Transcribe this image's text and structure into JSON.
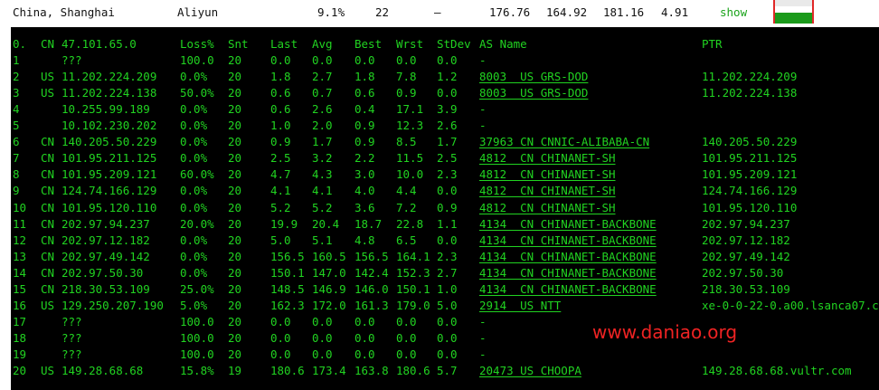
{
  "summary": {
    "location": "China, Shanghai",
    "provider": "Aliyun",
    "loss": "9.1%",
    "hops": "22",
    "dash": "–",
    "v1": "176.76",
    "v2": "164.92",
    "v3": "181.16",
    "v4": "4.91",
    "show_label": "show"
  },
  "colors": {
    "terminal_bg": "#000000",
    "terminal_text": "#21d321",
    "watermark": "#ef2323",
    "show_link": "#1aa31a"
  },
  "table": {
    "headers": [
      "0.",
      "CN",
      "47.101.65.0",
      "Loss%",
      "Snt",
      "Last",
      "Avg",
      "Best",
      "Wrst",
      "StDev",
      "AS Name",
      "PTR"
    ],
    "rows": [
      [
        "1",
        "",
        "???",
        "100.0",
        "20",
        "0.0",
        "0.0",
        "0.0",
        "0.0",
        "0.0",
        "-",
        ""
      ],
      [
        "2",
        "US",
        "11.202.224.209",
        "0.0%",
        "20",
        "1.8",
        "2.7",
        "1.8",
        "7.8",
        "1.2",
        "8003  US GRS-DOD",
        "11.202.224.209"
      ],
      [
        "3",
        "US",
        "11.202.224.138",
        "50.0%",
        "20",
        "0.6",
        "0.7",
        "0.6",
        "0.9",
        "0.0",
        "8003  US GRS-DOD",
        "11.202.224.138"
      ],
      [
        "4",
        "",
        "10.255.99.189",
        "0.0%",
        "20",
        "0.6",
        "2.6",
        "0.4",
        "17.1",
        "3.9",
        "-",
        ""
      ],
      [
        "5",
        "",
        "10.102.230.202",
        "0.0%",
        "20",
        "1.0",
        "2.0",
        "0.9",
        "12.3",
        "2.6",
        "-",
        ""
      ],
      [
        "6",
        "CN",
        "140.205.50.229",
        "0.0%",
        "20",
        "0.9",
        "1.7",
        "0.9",
        "8.5",
        "1.7",
        "37963 CN CNNIC-ALIBABA-CN",
        "140.205.50.229"
      ],
      [
        "7",
        "CN",
        "101.95.211.125",
        "0.0%",
        "20",
        "2.5",
        "3.2",
        "2.2",
        "11.5",
        "2.5",
        "4812  CN CHINANET-SH",
        "101.95.211.125"
      ],
      [
        "8",
        "CN",
        "101.95.209.121",
        "60.0%",
        "20",
        "4.7",
        "4.3",
        "3.0",
        "10.0",
        "2.3",
        "4812  CN CHINANET-SH",
        "101.95.209.121"
      ],
      [
        "9",
        "CN",
        "124.74.166.129",
        "0.0%",
        "20",
        "4.1",
        "4.1",
        "4.0",
        "4.4",
        "0.0",
        "4812  CN CHINANET-SH",
        "124.74.166.129"
      ],
      [
        "10",
        "CN",
        "101.95.120.110",
        "0.0%",
        "20",
        "5.2",
        "5.2",
        "3.6",
        "7.2",
        "0.9",
        "4812  CN CHINANET-SH",
        "101.95.120.110"
      ],
      [
        "11",
        "CN",
        "202.97.94.237",
        "20.0%",
        "20",
        "19.9",
        "20.4",
        "18.7",
        "22.8",
        "1.1",
        "4134  CN CHINANET-BACKBONE",
        "202.97.94.237"
      ],
      [
        "12",
        "CN",
        "202.97.12.182",
        "0.0%",
        "20",
        "5.0",
        "5.1",
        "4.8",
        "6.5",
        "0.0",
        "4134  CN CHINANET-BACKBONE",
        "202.97.12.182"
      ],
      [
        "13",
        "CN",
        "202.97.49.142",
        "0.0%",
        "20",
        "156.5",
        "160.5",
        "156.5",
        "164.1",
        "2.3",
        "4134  CN CHINANET-BACKBONE",
        "202.97.49.142"
      ],
      [
        "14",
        "CN",
        "202.97.50.30",
        "0.0%",
        "20",
        "150.1",
        "147.0",
        "142.4",
        "152.3",
        "2.7",
        "4134  CN CHINANET-BACKBONE",
        "202.97.50.30"
      ],
      [
        "15",
        "CN",
        "218.30.53.109",
        "25.0%",
        "20",
        "148.5",
        "146.9",
        "146.0",
        "150.1",
        "1.0",
        "4134  CN CHINANET-BACKBONE",
        "218.30.53.109"
      ],
      [
        "16",
        "US",
        "129.250.207.190",
        "5.0%",
        "20",
        "162.3",
        "172.0",
        "161.3",
        "179.0",
        "5.0",
        "2914  US NTT",
        "xe-0-0-22-0.a00.lsanca07.c"
      ],
      [
        "17",
        "",
        "???",
        "100.0",
        "20",
        "0.0",
        "0.0",
        "0.0",
        "0.0",
        "0.0",
        "-",
        ""
      ],
      [
        "18",
        "",
        "???",
        "100.0",
        "20",
        "0.0",
        "0.0",
        "0.0",
        "0.0",
        "0.0",
        "-",
        ""
      ],
      [
        "19",
        "",
        "???",
        "100.0",
        "20",
        "0.0",
        "0.0",
        "0.0",
        "0.0",
        "0.0",
        "-",
        ""
      ],
      [
        "20",
        "US",
        "149.28.68.68",
        "15.8%",
        "19",
        "180.6",
        "173.4",
        "163.8",
        "180.6",
        "5.7",
        "20473 US CHOOPA",
        "149.28.68.68.vultr.com"
      ]
    ]
  },
  "watermark": "www.daniao.org"
}
